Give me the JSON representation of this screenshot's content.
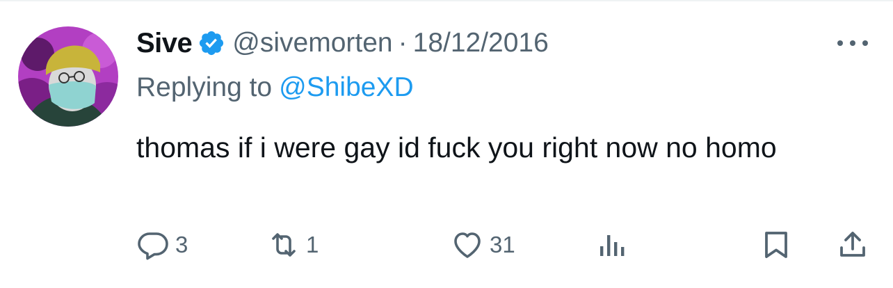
{
  "tweet": {
    "display_name": "Sive",
    "verified": true,
    "handle": "@sivemorten",
    "separator": "·",
    "date": "18/12/2016",
    "reply_prefix": "Replying to",
    "reply_handle": "@ShibeXD",
    "text": "thomas if i were gay id fuck you right now no homo",
    "more_icon": "more-icon"
  },
  "actions": {
    "replies": "3",
    "retweets": "1",
    "likes": "31",
    "icons": [
      "reply-icon",
      "retweet-icon",
      "like-icon",
      "views-icon",
      "bookmark-icon",
      "share-icon"
    ]
  },
  "colors": {
    "text": "#0f1419",
    "secondary": "#536471",
    "link": "#1d9bf0",
    "verified": "#1d9bf0",
    "divider": "#eff3f4"
  }
}
